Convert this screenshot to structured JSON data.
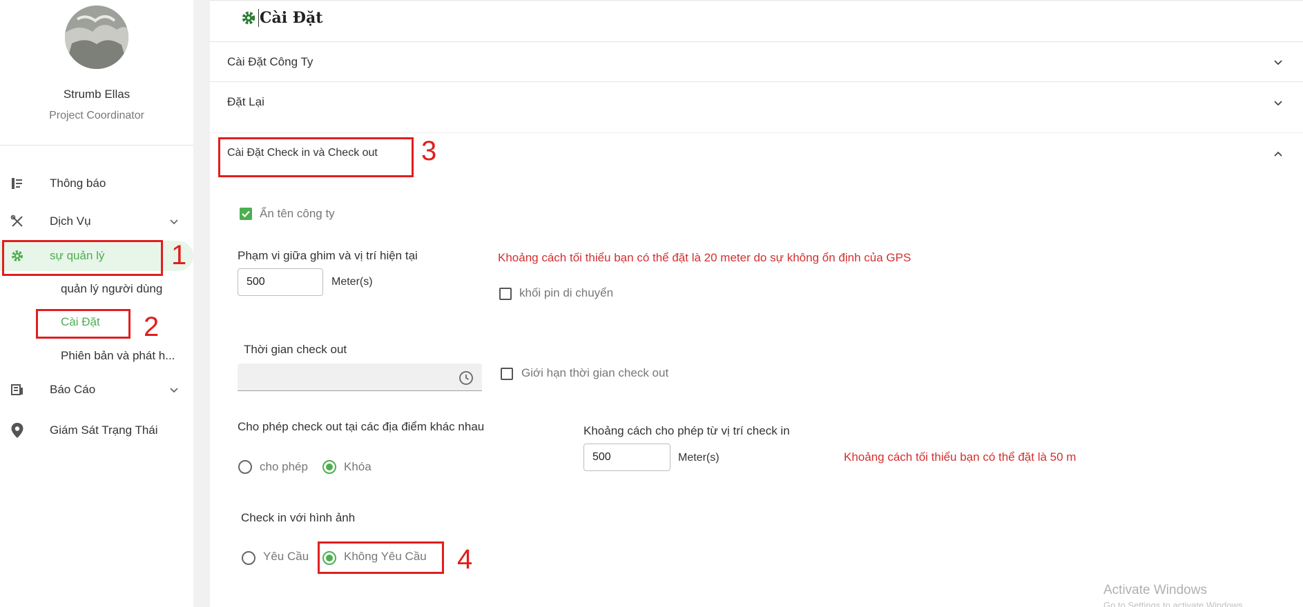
{
  "user": {
    "name": "Strumb Ellas",
    "role": "Project Coordinator"
  },
  "sidebar": {
    "items": [
      {
        "label": "Thông báo",
        "icon": "news-icon"
      },
      {
        "label": "Dịch Vụ",
        "icon": "tools-icon"
      },
      {
        "label": "sự quản lý",
        "icon": "gear-icon"
      },
      {
        "label": "Báo Cáo",
        "icon": "report-icon"
      },
      {
        "label": "Giám Sát Trạng Thái",
        "icon": "location-pin-icon"
      }
    ],
    "subitems": [
      {
        "label": "quản lý người dùng"
      },
      {
        "label": "Cài Đặt"
      },
      {
        "label": "Phiên bản và phát h..."
      }
    ]
  },
  "page": {
    "title": "Cài Đặt"
  },
  "accordions": [
    {
      "title": "Cài Đặt Công Ty"
    },
    {
      "title": "Đặt Lại"
    },
    {
      "title": "Cài Đặt Check in và Check out"
    }
  ],
  "checkin": {
    "hide_company_label": "Ẩn tên công ty",
    "hide_company_checked": true,
    "range_label": "Phạm vi giữa ghim và vị trí hiện tại",
    "range_value": "500",
    "range_unit": "Meter(s)",
    "range_note": "Khoảng cách tối thiểu bạn có thể đặt là 20 meter do sự không ổn định của GPS",
    "lock_pin_label": "khối pin di chuyển",
    "lock_pin_checked": false,
    "checkout_time_label": "Thời gian check out",
    "limit_checkout_label": "Giới hạn thời gian check out",
    "limit_checkout_checked": false,
    "allow_multi_label": "Cho phép check out tại các địa điểm khác nhau",
    "allow_option": "cho phép",
    "lock_option": "Khóa",
    "allow_multi_selected": "Khóa",
    "distance_label": "Khoảng cách cho phép từ vị trí check in",
    "distance_value": "500",
    "distance_unit": "Meter(s)",
    "distance_note": "Khoảng cách tối thiểu bạn có thể đặt là 50 m",
    "photo_label": "Check in với hình ảnh",
    "photo_required": "Yêu Cầu",
    "photo_not_required": "Không Yêu Cầu",
    "photo_selected": "Không Yêu Cầu"
  },
  "annotations": [
    "1",
    "2",
    "3",
    "4"
  ],
  "watermark": {
    "line1": "Activate Windows",
    "line2": "Go to Settings to activate Windows."
  },
  "colors": {
    "accent": "#4caf50",
    "annotation": "#e01e1e",
    "warning_text": "#d32f2f"
  }
}
